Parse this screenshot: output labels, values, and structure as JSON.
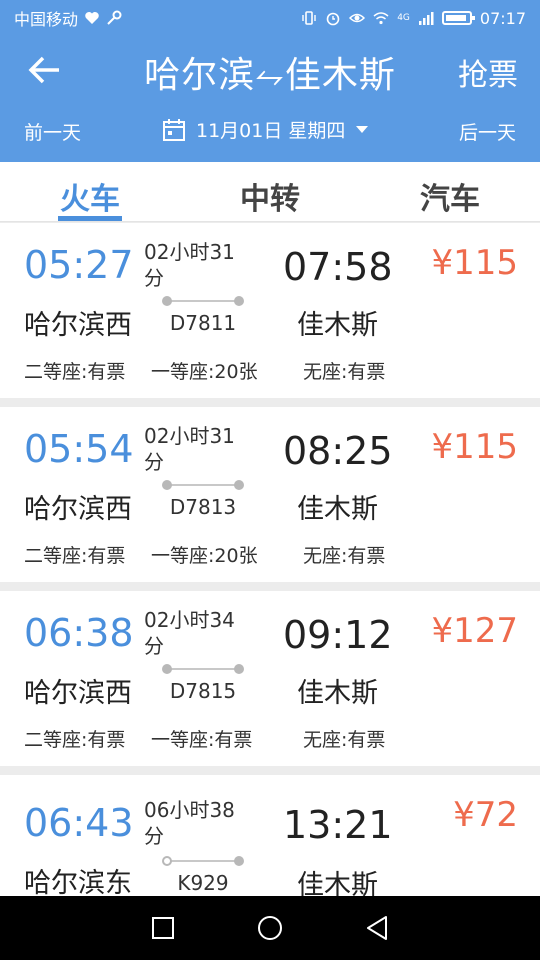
{
  "status": {
    "carrier": "中国移动",
    "network": "4G",
    "time": "07:17"
  },
  "header": {
    "back_icon": "arrow-left-icon",
    "route": "哈尔滨⥊佳木斯",
    "grab_label": "抢票",
    "prev_day": "前一天",
    "next_day": "后一天",
    "date": "11月01日 星期四",
    "calendar_icon": "calendar-icon",
    "dropdown_icon": "caret-down-icon"
  },
  "tabs": [
    {
      "label": "火车",
      "active": true
    },
    {
      "label": "中转",
      "active": false
    },
    {
      "label": "汽车",
      "active": false
    }
  ],
  "trains": [
    {
      "dep_time": "05:27",
      "duration": "02小时31分",
      "arr_time": "07:58",
      "price": "¥115",
      "dep_station": "哈尔滨西",
      "train_no": "D7811",
      "arr_station": "佳木斯",
      "seats": [
        "二等座:有票",
        "一等座:20张",
        "无座:有票"
      ]
    },
    {
      "dep_time": "05:54",
      "duration": "02小时31分",
      "arr_time": "08:25",
      "price": "¥115",
      "dep_station": "哈尔滨西",
      "train_no": "D7813",
      "arr_station": "佳木斯",
      "seats": [
        "二等座:有票",
        "一等座:20张",
        "无座:有票"
      ]
    },
    {
      "dep_time": "06:38",
      "duration": "02小时34分",
      "arr_time": "09:12",
      "price": "¥127",
      "dep_station": "哈尔滨西",
      "train_no": "D7815",
      "arr_station": "佳木斯",
      "seats": [
        "二等座:有票",
        "一等座:有票",
        "无座:有票"
      ]
    },
    {
      "dep_time": "06:43",
      "duration": "06小时38分",
      "arr_time": "13:21",
      "price": "¥72",
      "dep_station": "哈尔滨东",
      "train_no": "K929",
      "arr_station": "佳木斯",
      "seats": []
    }
  ],
  "colors": {
    "header_bg": "#5b9be3",
    "accent_blue": "#4a8fdc",
    "price": "#ee6b4d"
  }
}
